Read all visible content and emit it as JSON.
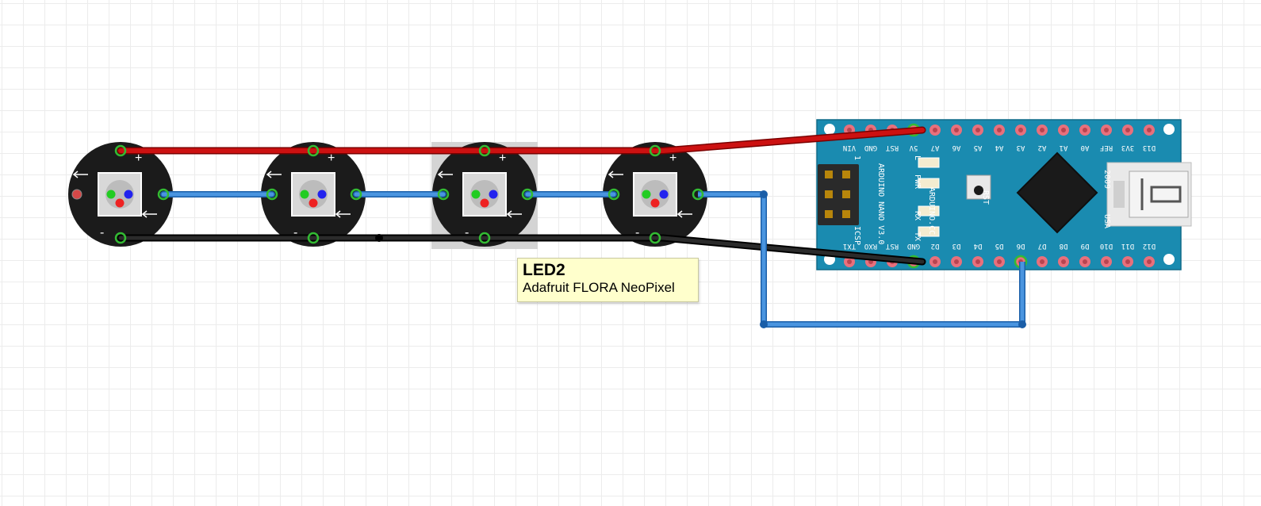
{
  "tooltip": {
    "title": "LED2",
    "subtitle": "Adafruit FLORA NeoPixel"
  },
  "neopixels": [
    {
      "id": "LED1",
      "selected": false
    },
    {
      "id": "LED-b",
      "selected": false
    },
    {
      "id": "LED2",
      "selected": true
    },
    {
      "id": "LED-d",
      "selected": false
    }
  ],
  "nano": {
    "top_pins": [
      "VIN",
      "GND",
      "RST",
      "5V",
      "A7",
      "A6",
      "A5",
      "A4",
      "A3",
      "A2",
      "A1",
      "A0",
      "REF",
      "3V3",
      "D13"
    ],
    "bottom_pins": [
      "TX1",
      "RXO",
      "RST",
      "GND",
      "D2",
      "D3",
      "D4",
      "D5",
      "D6",
      "D7",
      "D8",
      "D9",
      "D10",
      "D11",
      "D12"
    ],
    "labels": {
      "model": "ARDUINO NANO V3.0",
      "brand": "ARDUINO.CC",
      "year": "2009",
      "origin": "USA",
      "icsp": "ICSP",
      "pwr": "PWR",
      "rx": "RX",
      "tx": "TX",
      "led_l": "L",
      "rst": "RST",
      "pin1": "1"
    }
  },
  "colors": {
    "wire_red": "#cc1111",
    "wire_blue": "#3d86d4",
    "wire_black": "#1a1a1a",
    "board_teal": "#1a8bb0",
    "pad_pink": "#e8707c",
    "pin_green": "#33bb33",
    "tooltip_bg": "#ffffcc"
  }
}
